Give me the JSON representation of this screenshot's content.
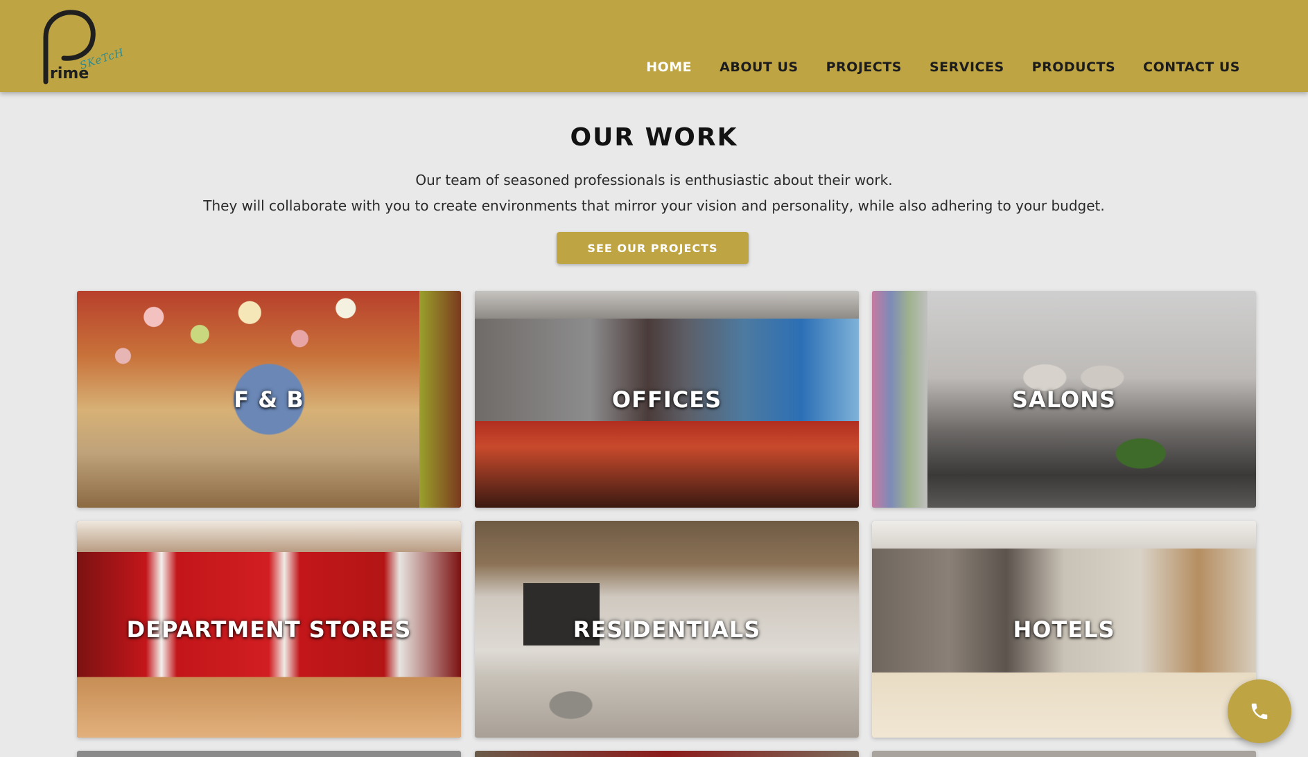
{
  "brand": {
    "logo_main": "rime",
    "logo_sub": "SKeTcH",
    "accent": "#bea443"
  },
  "nav": {
    "items": [
      {
        "label": "HOME",
        "active": true
      },
      {
        "label": "ABOUT US"
      },
      {
        "label": "PROJECTS"
      },
      {
        "label": "SERVICES"
      },
      {
        "label": "PRODUCTS"
      },
      {
        "label": "CONTACT US"
      }
    ]
  },
  "intro": {
    "title": "OUR WORK",
    "line1": "Our team of seasoned professionals is enthusiastic about their work.",
    "line2": "They will collaborate with you to create environments that mirror your vision and personality, while also adhering to your budget.",
    "cta_label": "SEE OUR PROJECTS"
  },
  "categories": [
    {
      "label": "F & B"
    },
    {
      "label": "OFFICES"
    },
    {
      "label": "SALONS"
    },
    {
      "label": "DEPARTMENT STORES"
    },
    {
      "label": "RESIDENTIALS"
    },
    {
      "label": "HOTELS"
    }
  ],
  "call_button": {
    "icon": "phone-icon"
  }
}
